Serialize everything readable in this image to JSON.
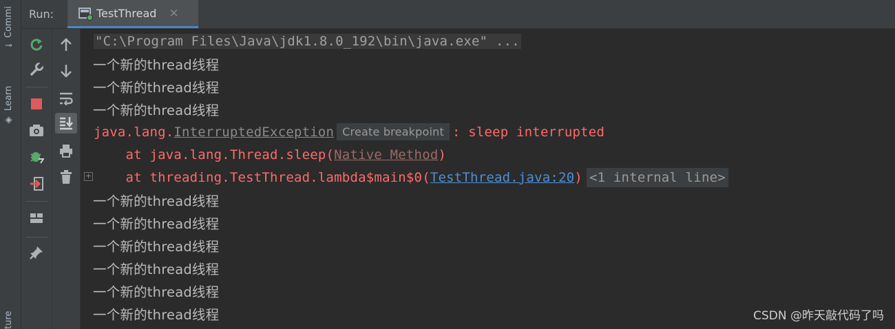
{
  "side_strip": {
    "commit_label": "Commi",
    "learn_label": "Learn",
    "structure_label": "ture",
    "commit_icon": "commit-icon",
    "learn_icon": "learn-icon"
  },
  "run_header": {
    "label": "Run:",
    "tab": {
      "title": "TestThread",
      "close": "×",
      "icon": "run-config-icon"
    }
  },
  "toolbar_left": [
    {
      "name": "rerun-button",
      "icon": "rerun-icon",
      "glyph": "↻",
      "color": "#59a869"
    },
    {
      "name": "settings-button",
      "icon": "wrench-icon",
      "glyph": "🔧",
      "color": "#afb1b3"
    },
    {
      "name": "stop-button",
      "icon": "stop-icon",
      "glyph": "■",
      "color": "#db5c5c"
    },
    {
      "name": "snapshot-button",
      "icon": "camera-icon",
      "glyph": "📷",
      "color": "#afb1b3"
    },
    {
      "name": "debug-button",
      "icon": "bug-icon",
      "glyph": "✱",
      "color": "#59a869"
    },
    {
      "name": "exit-button",
      "icon": "exit-icon",
      "glyph": "⇥",
      "color": "#db5c5c"
    },
    {
      "name": "layout-button",
      "icon": "layout-icon",
      "glyph": "▦",
      "color": "#afb1b3"
    },
    {
      "name": "pin-button",
      "icon": "pin-icon",
      "glyph": "📌",
      "color": "#afb1b3"
    }
  ],
  "toolbar_right": [
    {
      "name": "up-button",
      "icon": "arrow-up-icon",
      "glyph": "↑"
    },
    {
      "name": "down-button",
      "icon": "arrow-down-icon",
      "glyph": "↓"
    },
    {
      "name": "soft-wrap-button",
      "icon": "soft-wrap-icon",
      "glyph": "⤶"
    },
    {
      "name": "scroll-to-end-button",
      "icon": "scroll-to-end-icon",
      "glyph": "⤓",
      "active": true
    },
    {
      "name": "print-button",
      "icon": "print-icon",
      "glyph": "⎙"
    },
    {
      "name": "clear-button",
      "icon": "trash-icon",
      "glyph": "🗑"
    }
  ],
  "console": {
    "command": "\"C:\\Program Files\\Java\\jdk1.8.0_192\\bin\\java.exe\" ...",
    "thread_line": "一个新的thread线程",
    "exception": {
      "prefix": "java.lang.",
      "class_name": "InterruptedException",
      "hint": "Create breakpoint",
      "message": ": sleep interrupted"
    },
    "trace1": {
      "prefix": "    at java.lang.Thread.sleep(",
      "link": "Native Method",
      "suffix": ")"
    },
    "trace2": {
      "prefix": "    at threading.TestThread.lambda$main$0(",
      "link": "TestThread.java:20",
      "suffix": ")",
      "fold": "<1 internal line>"
    }
  },
  "watermark": "CSDN @昨天敲代码了吗",
  "colors": {
    "background": "#2b2b2b",
    "panel": "#3c3f41",
    "error": "#ff6b68",
    "link": "#4c8fd6",
    "text": "#bbbbbb"
  }
}
